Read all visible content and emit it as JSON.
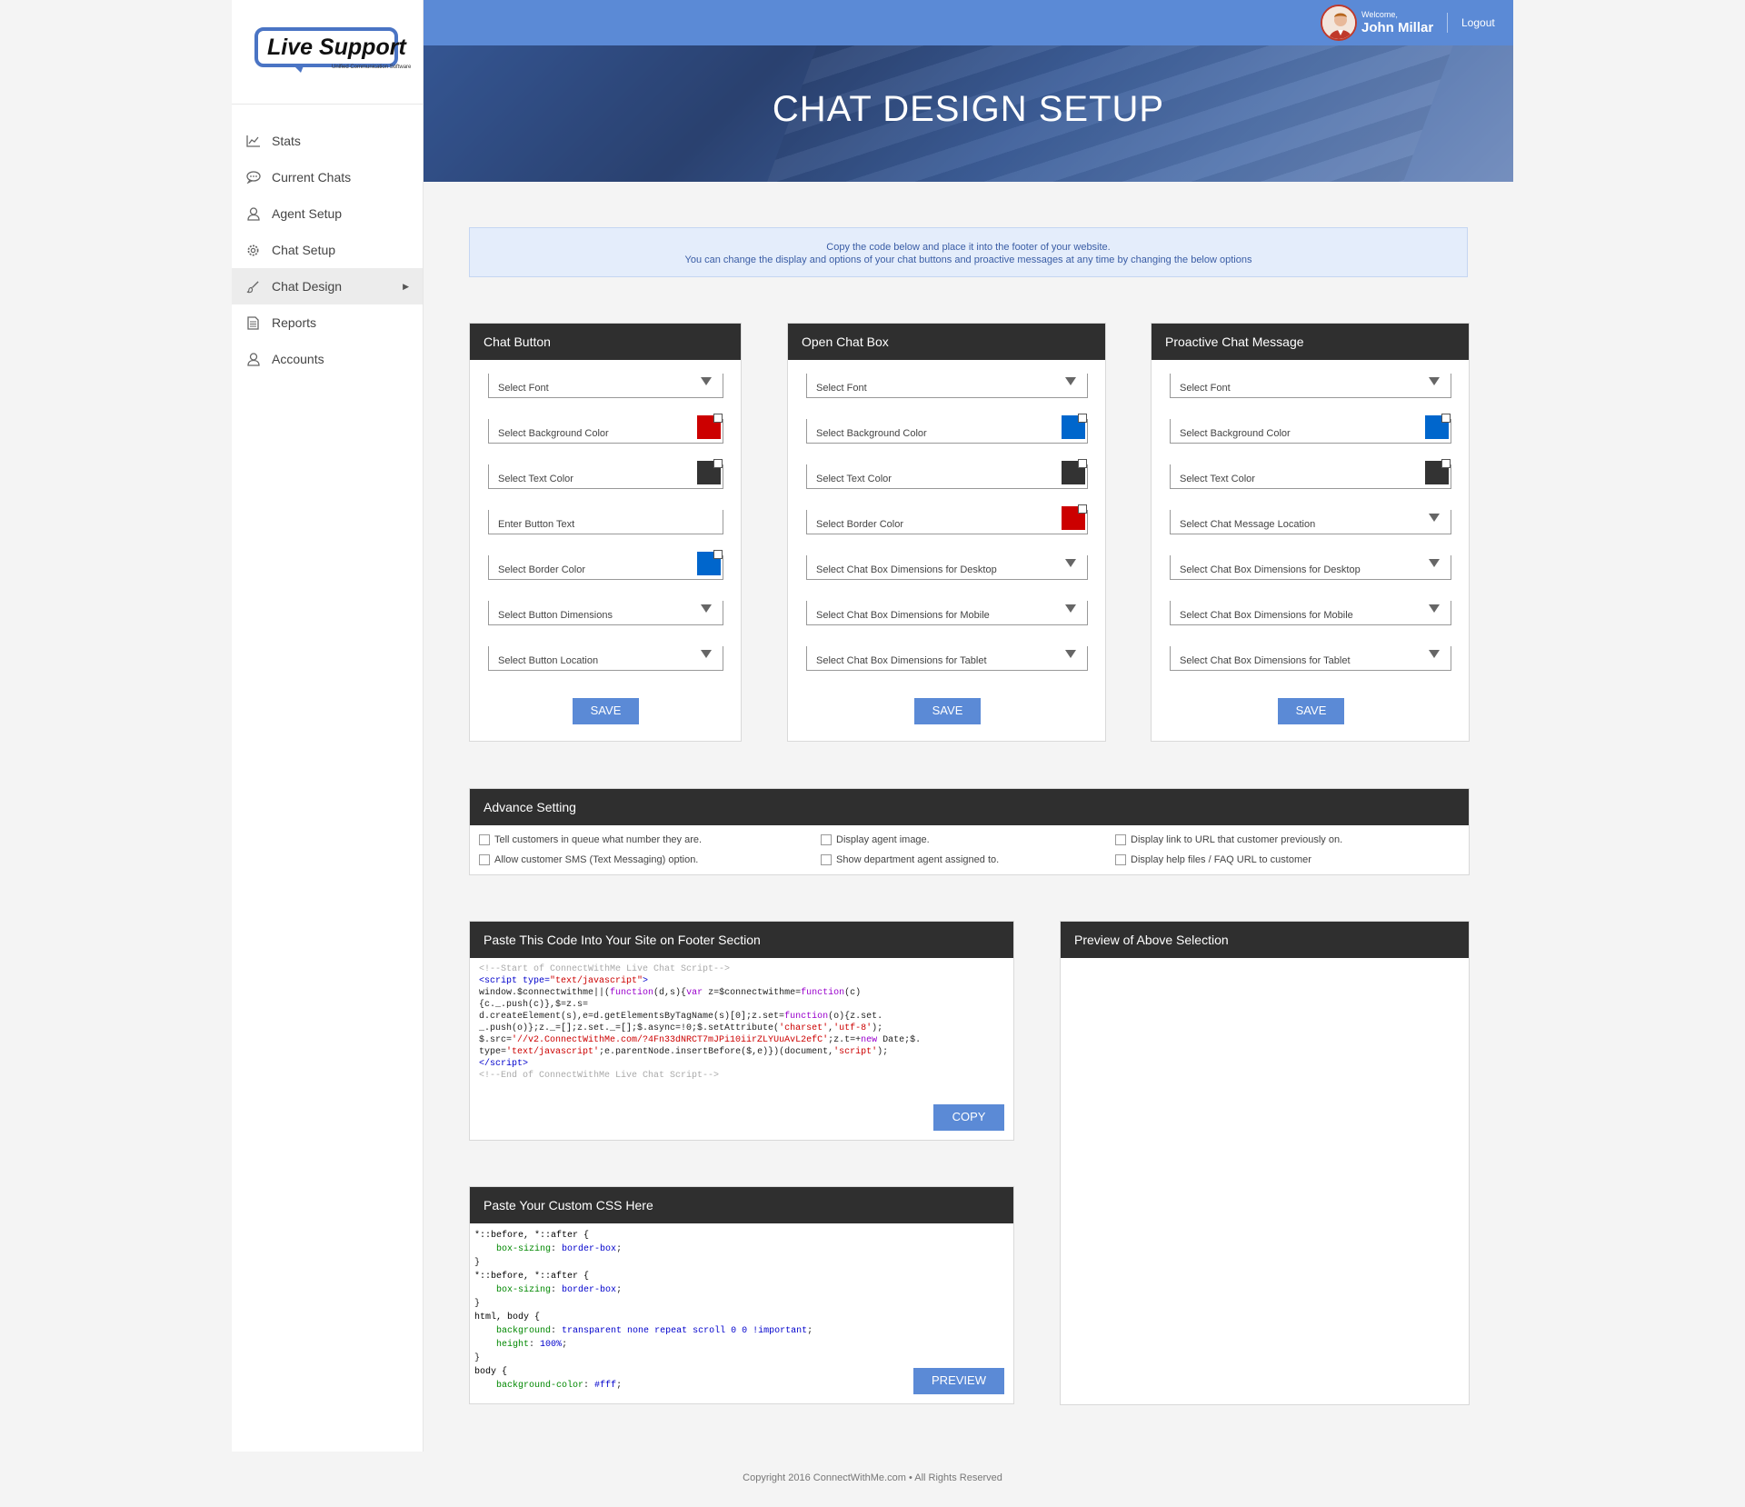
{
  "sidebar": {
    "logo_text": "Live Support",
    "logo_tagline": "Unified Communication Software",
    "items": [
      {
        "label": "Stats",
        "icon": "chart-icon"
      },
      {
        "label": "Current Chats",
        "icon": "chat-bubble-icon"
      },
      {
        "label": "Agent Setup",
        "icon": "user-icon"
      },
      {
        "label": "Chat Setup",
        "icon": "gear-icon"
      },
      {
        "label": "Chat Design",
        "icon": "brush-icon",
        "active": true
      },
      {
        "label": "Reports",
        "icon": "document-icon"
      },
      {
        "label": "Accounts",
        "icon": "user-icon"
      }
    ]
  },
  "topbar": {
    "welcome": "Welcome,",
    "user_name": "John Millar",
    "logout": "Logout",
    "color": "#5b8ad6"
  },
  "hero": {
    "title": "CHAT DESIGN SETUP"
  },
  "info": {
    "line1": "Copy the code below and place it into the footer of your website.",
    "line2": "You can change the display and options of your chat buttons and proactive messages at any time by changing the below options"
  },
  "chat_button": {
    "title": "Chat Button",
    "fields": [
      {
        "label": "Select Font",
        "type": "dropdown"
      },
      {
        "label": "Select Background Color",
        "type": "color",
        "color": "#cc0000"
      },
      {
        "label": "Select Text Color",
        "type": "color",
        "color": "#333333"
      },
      {
        "label": "Enter Button Text",
        "type": "text"
      },
      {
        "label": "Select Border Color",
        "type": "color",
        "color": "#0066cc"
      },
      {
        "label": "Select Button Dimensions",
        "type": "dropdown"
      },
      {
        "label": "Select Button Location",
        "type": "dropdown"
      }
    ],
    "save": "SAVE"
  },
  "open_chat_box": {
    "title": "Open Chat Box",
    "fields": [
      {
        "label": "Select Font",
        "type": "dropdown"
      },
      {
        "label": "Select Background Color",
        "type": "color",
        "color": "#0066cc"
      },
      {
        "label": "Select Text Color",
        "type": "color",
        "color": "#333333"
      },
      {
        "label": "Select Border Color",
        "type": "color",
        "color": "#cc0000"
      },
      {
        "label": "Select Chat Box Dimensions for Desktop",
        "type": "dropdown"
      },
      {
        "label": "Select Chat Box Dimensions for Mobile",
        "type": "dropdown"
      },
      {
        "label": "Select Chat Box Dimensions for Tablet",
        "type": "dropdown"
      }
    ],
    "save": "SAVE"
  },
  "proactive": {
    "title": "Proactive Chat Message",
    "fields": [
      {
        "label": "Select Font",
        "type": "dropdown"
      },
      {
        "label": "Select Background Color",
        "type": "color",
        "color": "#0066cc"
      },
      {
        "label": "Select Text Color",
        "type": "color",
        "color": "#333333"
      },
      {
        "label": "Select Chat Message Location",
        "type": "dropdown"
      },
      {
        "label": "Select Chat Box Dimensions for Desktop",
        "type": "dropdown"
      },
      {
        "label": "Select Chat Box Dimensions for Mobile",
        "type": "dropdown"
      },
      {
        "label": "Select Chat Box Dimensions for Tablet",
        "type": "dropdown"
      }
    ],
    "save": "SAVE"
  },
  "advance": {
    "title": "Advance Setting",
    "options": [
      "Tell customers in queue what number they are.",
      "Allow customer SMS (Text Messaging) option.",
      "Display agent image.",
      "Show department agent assigned to.",
      "Display link to URL that customer previously on.",
      "Display help files / FAQ URL to customer"
    ]
  },
  "code_panel": {
    "title": "Paste This Code Into Your Site on Footer Section",
    "copy": "COPY"
  },
  "css_panel": {
    "title": "Paste Your Custom CSS Here",
    "preview": "PREVIEW"
  },
  "preview_panel": {
    "title": "Preview of Above Selection"
  },
  "footer": {
    "text": "Copyright 2016 ConnectWithMe.com  •  All Rights Reserved"
  }
}
